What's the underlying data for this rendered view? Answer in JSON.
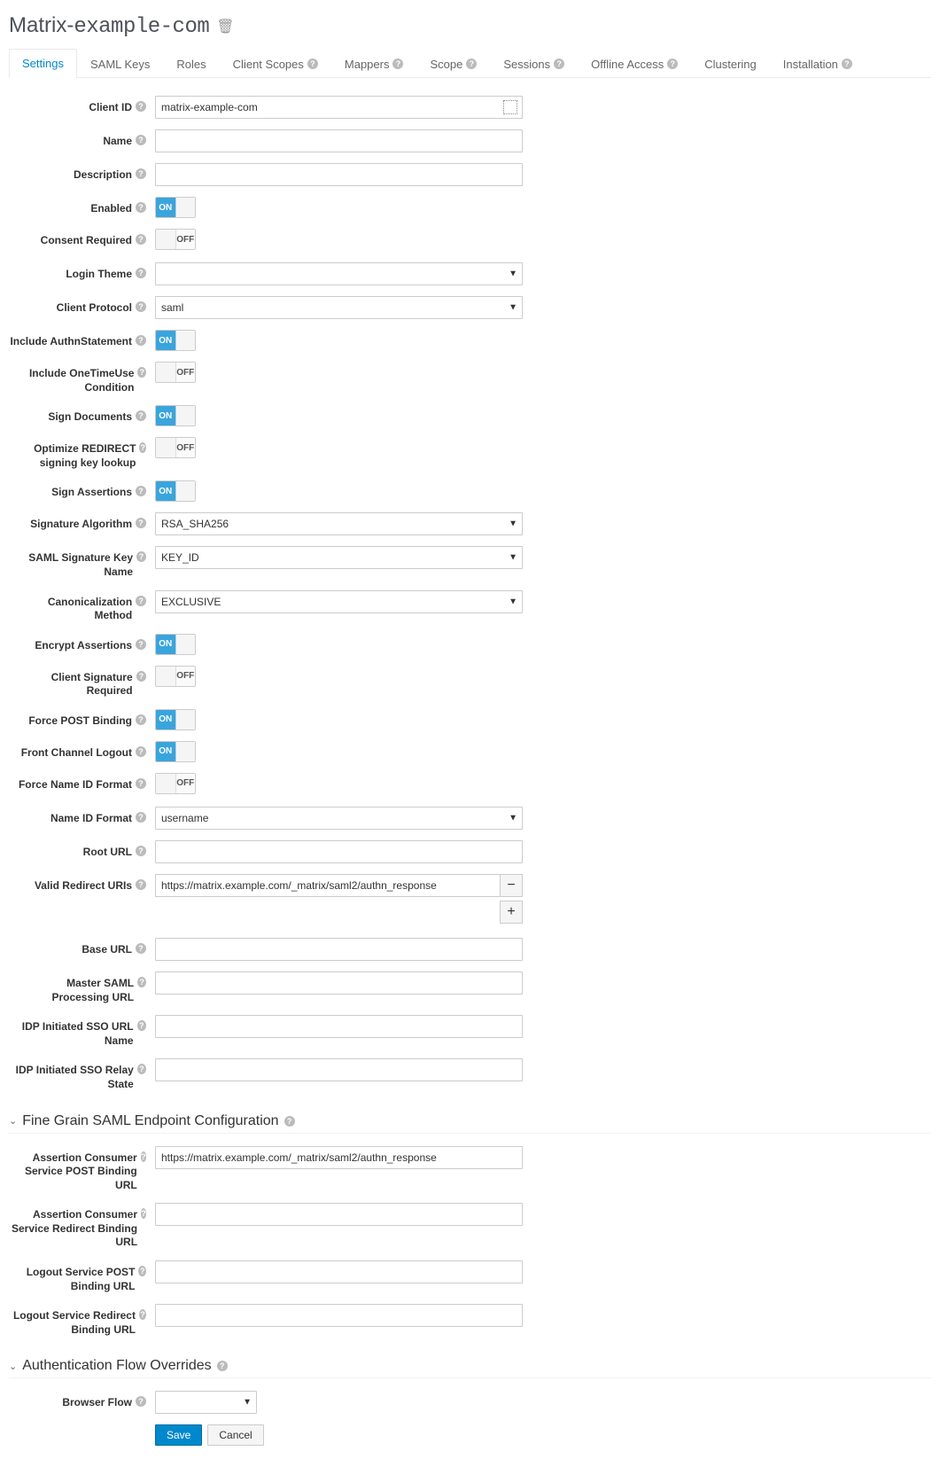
{
  "header": {
    "title_pre": "Matrix-",
    "title_mono": "example-com"
  },
  "tabs": [
    {
      "label": "Settings",
      "help": false
    },
    {
      "label": "SAML Keys",
      "help": false
    },
    {
      "label": "Roles",
      "help": false
    },
    {
      "label": "Client Scopes",
      "help": true
    },
    {
      "label": "Mappers",
      "help": true
    },
    {
      "label": "Scope",
      "help": true
    },
    {
      "label": "Sessions",
      "help": true
    },
    {
      "label": "Offline Access",
      "help": true
    },
    {
      "label": "Clustering",
      "help": false
    },
    {
      "label": "Installation",
      "help": true
    }
  ],
  "toggle_on": "ON",
  "toggle_off": "OFF",
  "form": {
    "client_id": {
      "label": "Client ID",
      "value": "matrix-example-com"
    },
    "name": {
      "label": "Name",
      "value": ""
    },
    "description": {
      "label": "Description",
      "value": ""
    },
    "enabled": {
      "label": "Enabled",
      "value": "on"
    },
    "consent_required": {
      "label": "Consent Required",
      "value": "off"
    },
    "login_theme": {
      "label": "Login Theme",
      "value": ""
    },
    "client_protocol": {
      "label": "Client Protocol",
      "value": "saml"
    },
    "include_authn": {
      "label": "Include AuthnStatement",
      "value": "on"
    },
    "one_time_use": {
      "label": "Include OneTimeUse Condition",
      "value": "off"
    },
    "sign_documents": {
      "label": "Sign Documents",
      "value": "on"
    },
    "optimize_redirect": {
      "label": "Optimize REDIRECT signing key lookup",
      "value": "off"
    },
    "sign_assertions": {
      "label": "Sign Assertions",
      "value": "on"
    },
    "sig_algorithm": {
      "label": "Signature Algorithm",
      "value": "RSA_SHA256"
    },
    "sig_key_name": {
      "label": "SAML Signature Key Name",
      "value": "KEY_ID"
    },
    "canon_method": {
      "label": "Canonicalization Method",
      "value": "EXCLUSIVE"
    },
    "encrypt_assertions": {
      "label": "Encrypt Assertions",
      "value": "on"
    },
    "client_sig_required": {
      "label": "Client Signature Required",
      "value": "off"
    },
    "force_post": {
      "label": "Force POST Binding",
      "value": "on"
    },
    "front_channel_logout": {
      "label": "Front Channel Logout",
      "value": "on"
    },
    "force_nameid": {
      "label": "Force Name ID Format",
      "value": "off"
    },
    "nameid_format": {
      "label": "Name ID Format",
      "value": "username"
    },
    "root_url": {
      "label": "Root URL",
      "value": ""
    },
    "valid_redirect": {
      "label": "Valid Redirect URIs",
      "value": "https://matrix.example.com/_matrix/saml2/authn_response"
    },
    "base_url": {
      "label": "Base URL",
      "value": ""
    },
    "master_saml": {
      "label": "Master SAML Processing URL",
      "value": ""
    },
    "idp_sso_url_name": {
      "label": "IDP Initiated SSO URL Name",
      "value": ""
    },
    "idp_sso_relay": {
      "label": "IDP Initiated SSO Relay State",
      "value": ""
    }
  },
  "section_fine": "Fine Grain SAML Endpoint Configuration",
  "fine": {
    "acs_post": {
      "label": "Assertion Consumer Service POST Binding URL",
      "value": "https://matrix.example.com/_matrix/saml2/authn_response"
    },
    "acs_redirect": {
      "label": "Assertion Consumer Service Redirect Binding URL",
      "value": ""
    },
    "logout_post": {
      "label": "Logout Service POST Binding URL",
      "value": ""
    },
    "logout_redirect": {
      "label": "Logout Service Redirect Binding URL",
      "value": ""
    }
  },
  "section_auth": "Authentication Flow Overrides",
  "auth": {
    "browser_flow": {
      "label": "Browser Flow",
      "value": ""
    }
  },
  "actions": {
    "save": "Save",
    "cancel": "Cancel"
  }
}
